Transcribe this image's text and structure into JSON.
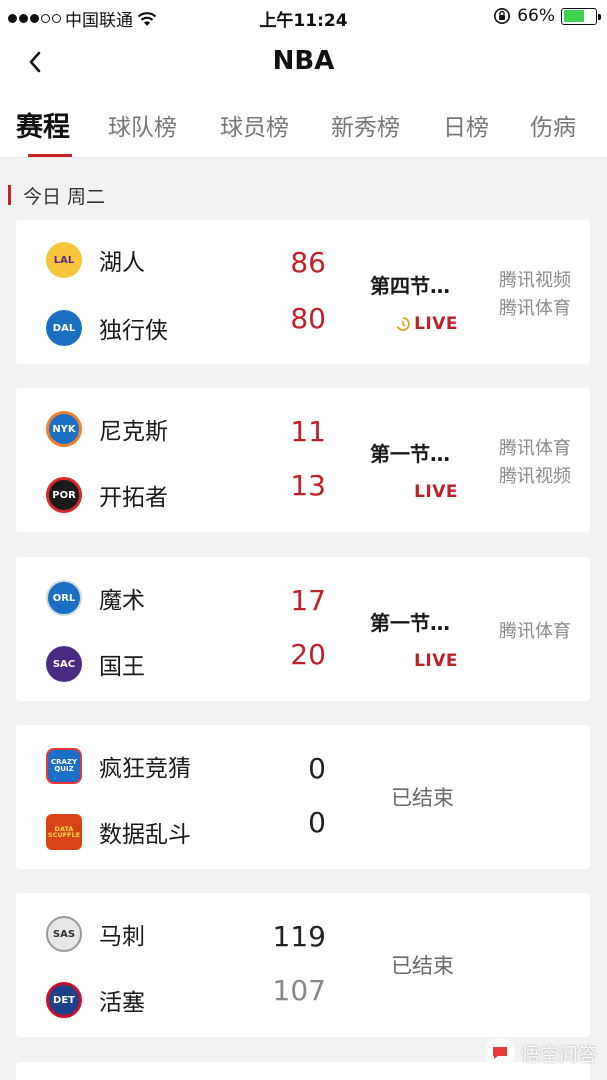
{
  "status_bar": {
    "carrier": "中国联通",
    "time": "上午11:24",
    "battery": "66%",
    "battery_level": 0.66,
    "battery_color": "#3dd34b"
  },
  "nav": {
    "title": "NBA"
  },
  "tabs": [
    {
      "label": "赛程",
      "active": true
    },
    {
      "label": "球队榜"
    },
    {
      "label": "球员榜"
    },
    {
      "label": "新秀榜"
    },
    {
      "label": "日榜"
    },
    {
      "label": "伤病"
    }
  ],
  "section": {
    "label": "今日 周二"
  },
  "games": [
    {
      "home": {
        "abbr": "LAL",
        "name": "湖人",
        "score": "86"
      },
      "away": {
        "abbr": "DAL",
        "name": "独行侠",
        "score": "80"
      },
      "status": "第四节…",
      "live": "LIVE",
      "broadcast": [
        "腾讯视频",
        "腾讯体育"
      ]
    },
    {
      "home": {
        "abbr": "NYK",
        "name": "尼克斯",
        "score": "11"
      },
      "away": {
        "abbr": "POR",
        "name": "开拓者",
        "score": "13"
      },
      "status": "第一节…",
      "live": "LIVE",
      "broadcast": [
        "腾讯体育",
        "腾讯视频"
      ]
    },
    {
      "home": {
        "abbr": "ORL",
        "name": "魔术",
        "score": "17"
      },
      "away": {
        "abbr": "SAC",
        "name": "国王",
        "score": "20"
      },
      "status": "第一节…",
      "live": "LIVE",
      "broadcast": [
        "腾讯体育"
      ]
    },
    {
      "home": {
        "abbr": "CRAZY QUIZ",
        "name": "疯狂竞猜",
        "score": "0"
      },
      "away": {
        "abbr": "DATA SCUFFLE",
        "name": "数据乱斗",
        "score": "0"
      },
      "status": "已结束"
    },
    {
      "home": {
        "abbr": "SAS",
        "name": "马刺",
        "score": "119"
      },
      "away": {
        "abbr": "DET",
        "name": "活塞",
        "score": "107"
      },
      "status": "已结束"
    }
  ],
  "watermark": {
    "text": "悟空问答"
  },
  "colors": {
    "accent": "#c8202a",
    "score": "#c0202a"
  }
}
